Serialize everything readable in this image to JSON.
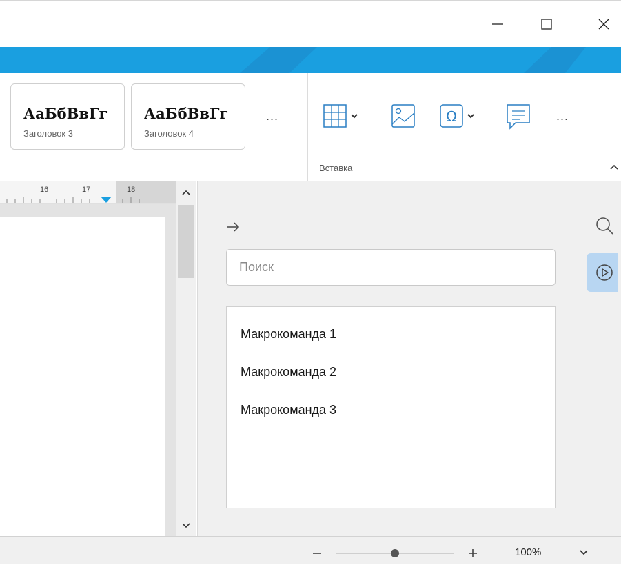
{
  "window": {
    "minimize_icon": "minimize-icon",
    "maximize_icon": "maximize-icon",
    "close_icon": "close-icon"
  },
  "ribbon": {
    "styles": [
      {
        "preview": "АаБбВвГг",
        "name": "Заголовок 3"
      },
      {
        "preview": "АаБбВвГг",
        "name": "Заголовок 4"
      }
    ],
    "more_styles": "...",
    "insert_group_label": "Вставка",
    "insert_more": "...",
    "icons": [
      "table-icon",
      "image-icon",
      "special-char-icon",
      "comment-icon"
    ]
  },
  "ruler": {
    "numbers": [
      "16",
      "17",
      "18"
    ]
  },
  "panel": {
    "search_placeholder": "Поиск",
    "macros": [
      "Макрокоманда 1",
      "Макрокоманда 2",
      "Макрокоманда 3"
    ]
  },
  "status": {
    "zoom": "100%",
    "zoom_level": 0.5
  },
  "colors": {
    "accent": "#1a9fe0",
    "selected_tab": "#b8d6f2"
  }
}
